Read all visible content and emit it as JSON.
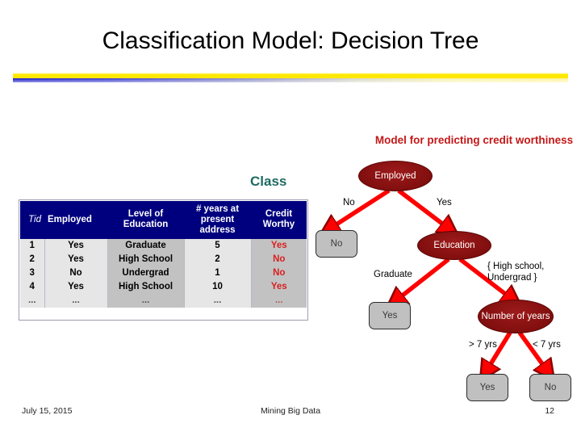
{
  "slide": {
    "title": "Classification Model: Decision Tree",
    "class_label": "Class",
    "tree_heading": "Model for predicting credit worthiness"
  },
  "table": {
    "headers": [
      "Tid",
      "Employed",
      "Level of Education",
      "# years at present address",
      "Credit Worthy"
    ],
    "rows": [
      {
        "tid": "1",
        "employed": "Yes",
        "education": "Graduate",
        "years": "5",
        "credit_worthy": "Yes"
      },
      {
        "tid": "2",
        "employed": "Yes",
        "education": "High School",
        "years": "2",
        "credit_worthy": "No"
      },
      {
        "tid": "3",
        "employed": "No",
        "education": "Undergrad",
        "years": "1",
        "credit_worthy": "No"
      },
      {
        "tid": "4",
        "employed": "Yes",
        "education": "High School",
        "years": "10",
        "credit_worthy": "Yes"
      },
      {
        "tid": "...",
        "employed": "...",
        "education": "...",
        "years": "...",
        "credit_worthy": "..."
      }
    ]
  },
  "tree": {
    "nodes": {
      "root": "Employed",
      "education": "Education",
      "number_of_years": "Number of years",
      "leaf_no_left": "No",
      "leaf_yes_graduate": "Yes",
      "leaf_yes_gt7": "Yes",
      "leaf_no_lt7": "No"
    },
    "edges": {
      "employed_no": "No",
      "employed_yes": "Yes",
      "education_graduate": "Graduate",
      "education_other": "{ High school, Undergrad }",
      "years_gt": "> 7 yrs",
      "years_lt": "< 7 yrs"
    }
  },
  "footer": {
    "date": "July 15, 2015",
    "center": "Mining Big Data",
    "page": "12"
  },
  "colors": {
    "header_navy": "#00007e",
    "node_dark_red": "#8b1111",
    "arrow_red": "#ff0000",
    "heading_red": "#c41818",
    "class_teal": "#1f6b63",
    "leaf_gray": "#c0c0c0",
    "credit_red": "#d82020",
    "divider_yellow": "#ffe800",
    "divider_blue": "#1616c8"
  }
}
